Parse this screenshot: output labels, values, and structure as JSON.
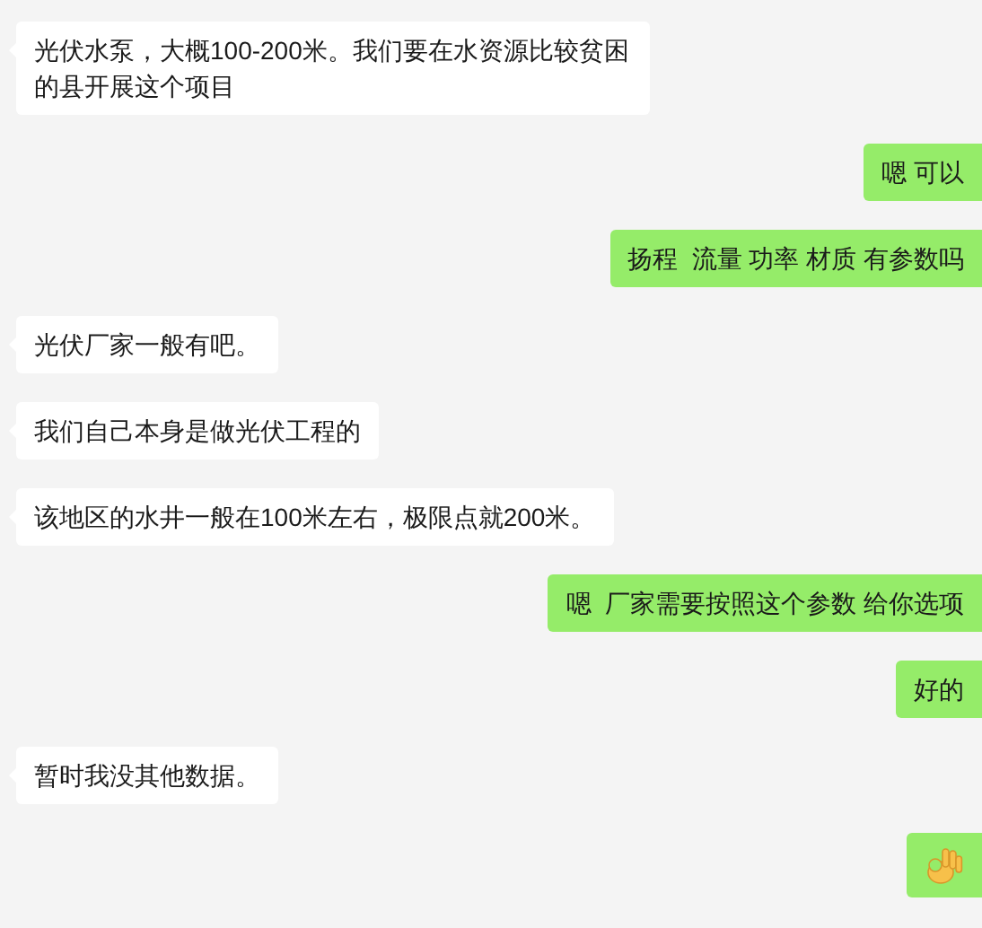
{
  "messages": [
    {
      "outgoing": false,
      "kind": "text",
      "text": "光伏水泵，大概100-200米。我们要在水资源比较贫困的县开展这个项目"
    },
    {
      "outgoing": true,
      "kind": "text",
      "text": "嗯 可以"
    },
    {
      "outgoing": true,
      "kind": "text",
      "text": "扬程  流量 功率 材质 有参数吗"
    },
    {
      "outgoing": false,
      "kind": "text",
      "text": "光伏厂家一般有吧。"
    },
    {
      "outgoing": false,
      "kind": "text",
      "text": "我们自己本身是做光伏工程的"
    },
    {
      "outgoing": false,
      "kind": "text",
      "text": "该地区的水井一般在100米左右，极限点就200米。"
    },
    {
      "outgoing": true,
      "kind": "text",
      "text": "嗯  厂家需要按照这个参数 给你选项"
    },
    {
      "outgoing": true,
      "kind": "text",
      "text": "好的"
    },
    {
      "outgoing": false,
      "kind": "text",
      "text": "暂时我没其他数据。"
    },
    {
      "outgoing": true,
      "kind": "emoji"
    }
  ]
}
